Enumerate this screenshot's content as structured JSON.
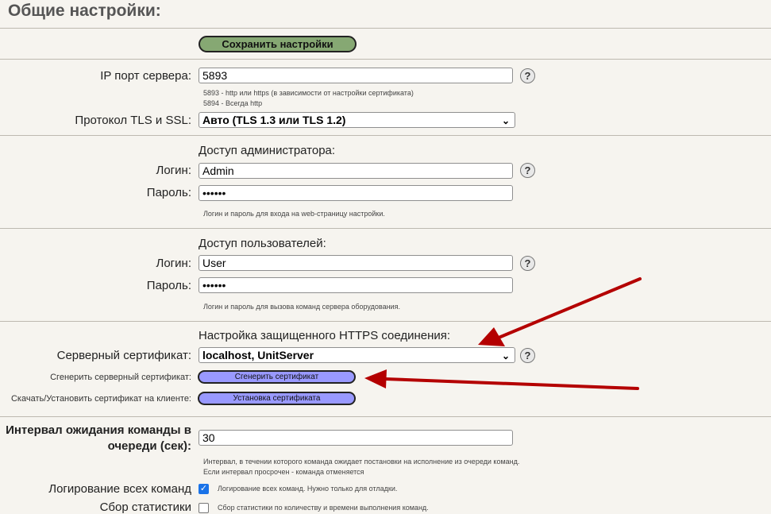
{
  "page": {
    "title": "Общие настройки:"
  },
  "save_button": "Сохранить настройки",
  "server": {
    "port_label": "IP порт сервера:",
    "port_value": "5893",
    "port_hint_1": "5893 - http или https (в зависимости от настройки сертификата)",
    "port_hint_2": "5894 - Всегда http",
    "tls_label": "Протокол TLS и SSL:",
    "tls_value": "Авто (TLS 1.3 или TLS 1.2)"
  },
  "admin": {
    "title": "Доступ администратора:",
    "login_label": "Логин:",
    "login_value": "Admin",
    "password_label": "Пароль:",
    "password_value": "••••••",
    "hint": "Логин и пароль для входа на web-страницу настройки."
  },
  "users": {
    "title": "Доступ пользователей:",
    "login_label": "Логин:",
    "login_value": "User",
    "password_label": "Пароль:",
    "password_value": "••••••",
    "hint": "Логин и пароль для вызова команд сервера оборудования."
  },
  "https": {
    "title": "Настройка защищенного HTTPS соединения:",
    "cert_label": "Серверный сертификат:",
    "cert_value": "localhost, UnitServer",
    "generate_label": "Сгенерить серверный сертификат:",
    "generate_button": "Сгенерить сертификат",
    "install_label": "Скачать/Установить сертификат на клиенте:",
    "install_button": "Установка сертификата"
  },
  "queue": {
    "label_line1": "Интервал ожидания команды в",
    "label_line2": "очереди (сек):",
    "value": "30",
    "hint_1": "Интервал, в течении которого команда ожидает постановки на исполнение из очереди команд.",
    "hint_2": "Если интервал просрочен - команда отменяется"
  },
  "logging": {
    "label": "Логирование всех команд",
    "checked": true,
    "hint": "Логирование всех команд. Нужно только для отладки."
  },
  "stats": {
    "label": "Сбор статистики",
    "checked": false,
    "hint": "Сбор статистики по количеству и времени выполнения команд."
  },
  "colors": {
    "arrow": "#b40000",
    "save_button": "#86a873",
    "action_button": "#9999ff"
  },
  "icons": {
    "help": "question-circle-icon",
    "dropdown": "chevron-down-icon",
    "check": "checkmark-icon"
  },
  "glyphs": {
    "help": "?",
    "chevron": "⌄",
    "check": "✓"
  }
}
